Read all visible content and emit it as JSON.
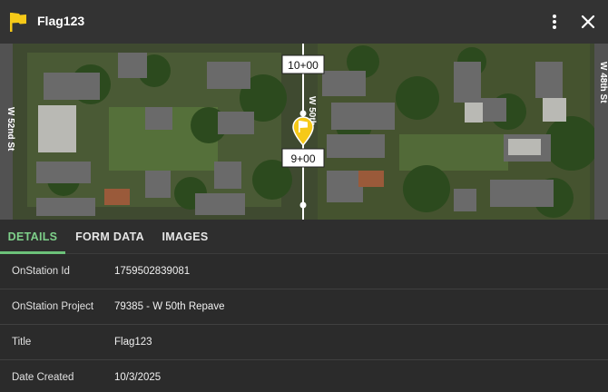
{
  "header": {
    "title": "Flag123",
    "accent_color": "#f6c918",
    "icons": [
      "flag-icon",
      "more-vert-icon",
      "close-icon"
    ]
  },
  "map": {
    "street_left": "W 52nd St",
    "street_center": "W 50th",
    "street_right": "W 48th St",
    "station_top": "10+00",
    "station_bottom": "9+00"
  },
  "tabs": [
    {
      "label": "DETAILS",
      "active": true
    },
    {
      "label": "FORM DATA",
      "active": false
    },
    {
      "label": "IMAGES",
      "active": false
    }
  ],
  "details": [
    {
      "label": "OnStation Id",
      "value": "1759502839081"
    },
    {
      "label": "OnStation Project",
      "value": "79385 - W 50th Repave"
    },
    {
      "label": "Title",
      "value": "Flag123"
    },
    {
      "label": "Date Created",
      "value": "10/3/2025"
    }
  ]
}
